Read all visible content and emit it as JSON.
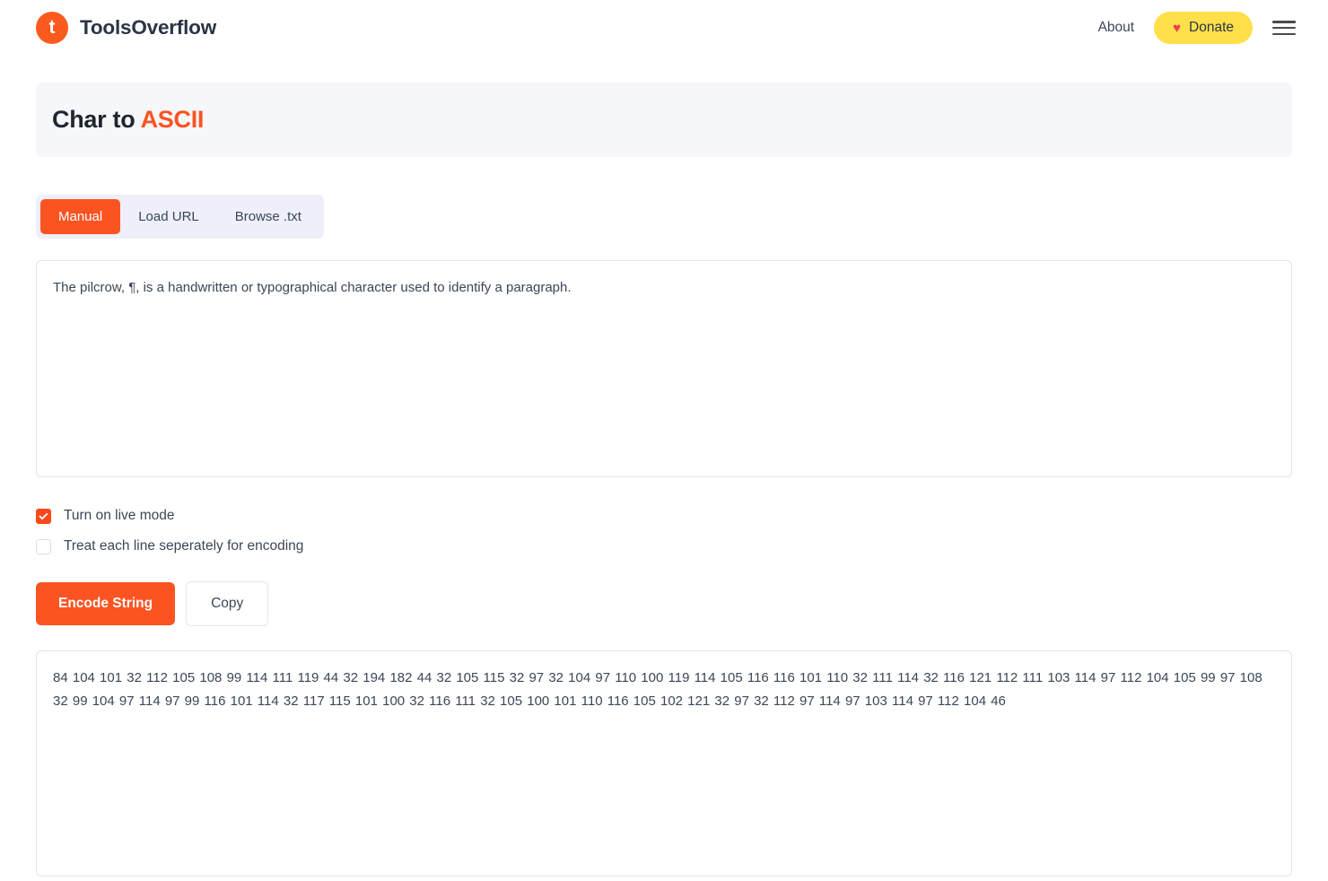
{
  "header": {
    "logo_letter": "t",
    "brand_name": "ToolsOverflow",
    "about_label": "About",
    "donate_label": "Donate",
    "heart_glyph": "♥",
    "brand_color": "#fb5a1e",
    "donate_color": "#ffe04b",
    "heart_color": "#ef3b4c"
  },
  "page_title": {
    "prefix": "Char to ",
    "accent": "ASCII",
    "accent_color": "#fb5422"
  },
  "tabs": [
    {
      "label": "Manual",
      "active": true
    },
    {
      "label": "Load URL",
      "active": false
    },
    {
      "label": "Browse .txt",
      "active": false
    }
  ],
  "input": {
    "value": "The pilcrow, ¶, is a handwritten or typographical character used to identify a paragraph.",
    "placeholder": ""
  },
  "options": [
    {
      "label": "Turn on live mode",
      "checked": true
    },
    {
      "label": "Treat each line seperately for encoding",
      "checked": false
    }
  ],
  "buttons": {
    "encode_label": "Encode String",
    "copy_label": "Copy"
  },
  "output": {
    "value": "84 104 101 32 112 105 108 99 114 111 119 44 32 194 182 44 32 105 115 32 97 32 104 97 110 100 119 114 105 116 116 101 110 32 111 114 32 116 121 112 111 103 114 97 112 104 105 99 97 108 32 99 104 97 114 97 99 116 101 114 32 117 115 101 100 32 116 111 32 105 100 101 110 116 105 102 121 32 97 32 112 97 114 97 103 114 97 112 104 46",
    "placeholder": ""
  }
}
